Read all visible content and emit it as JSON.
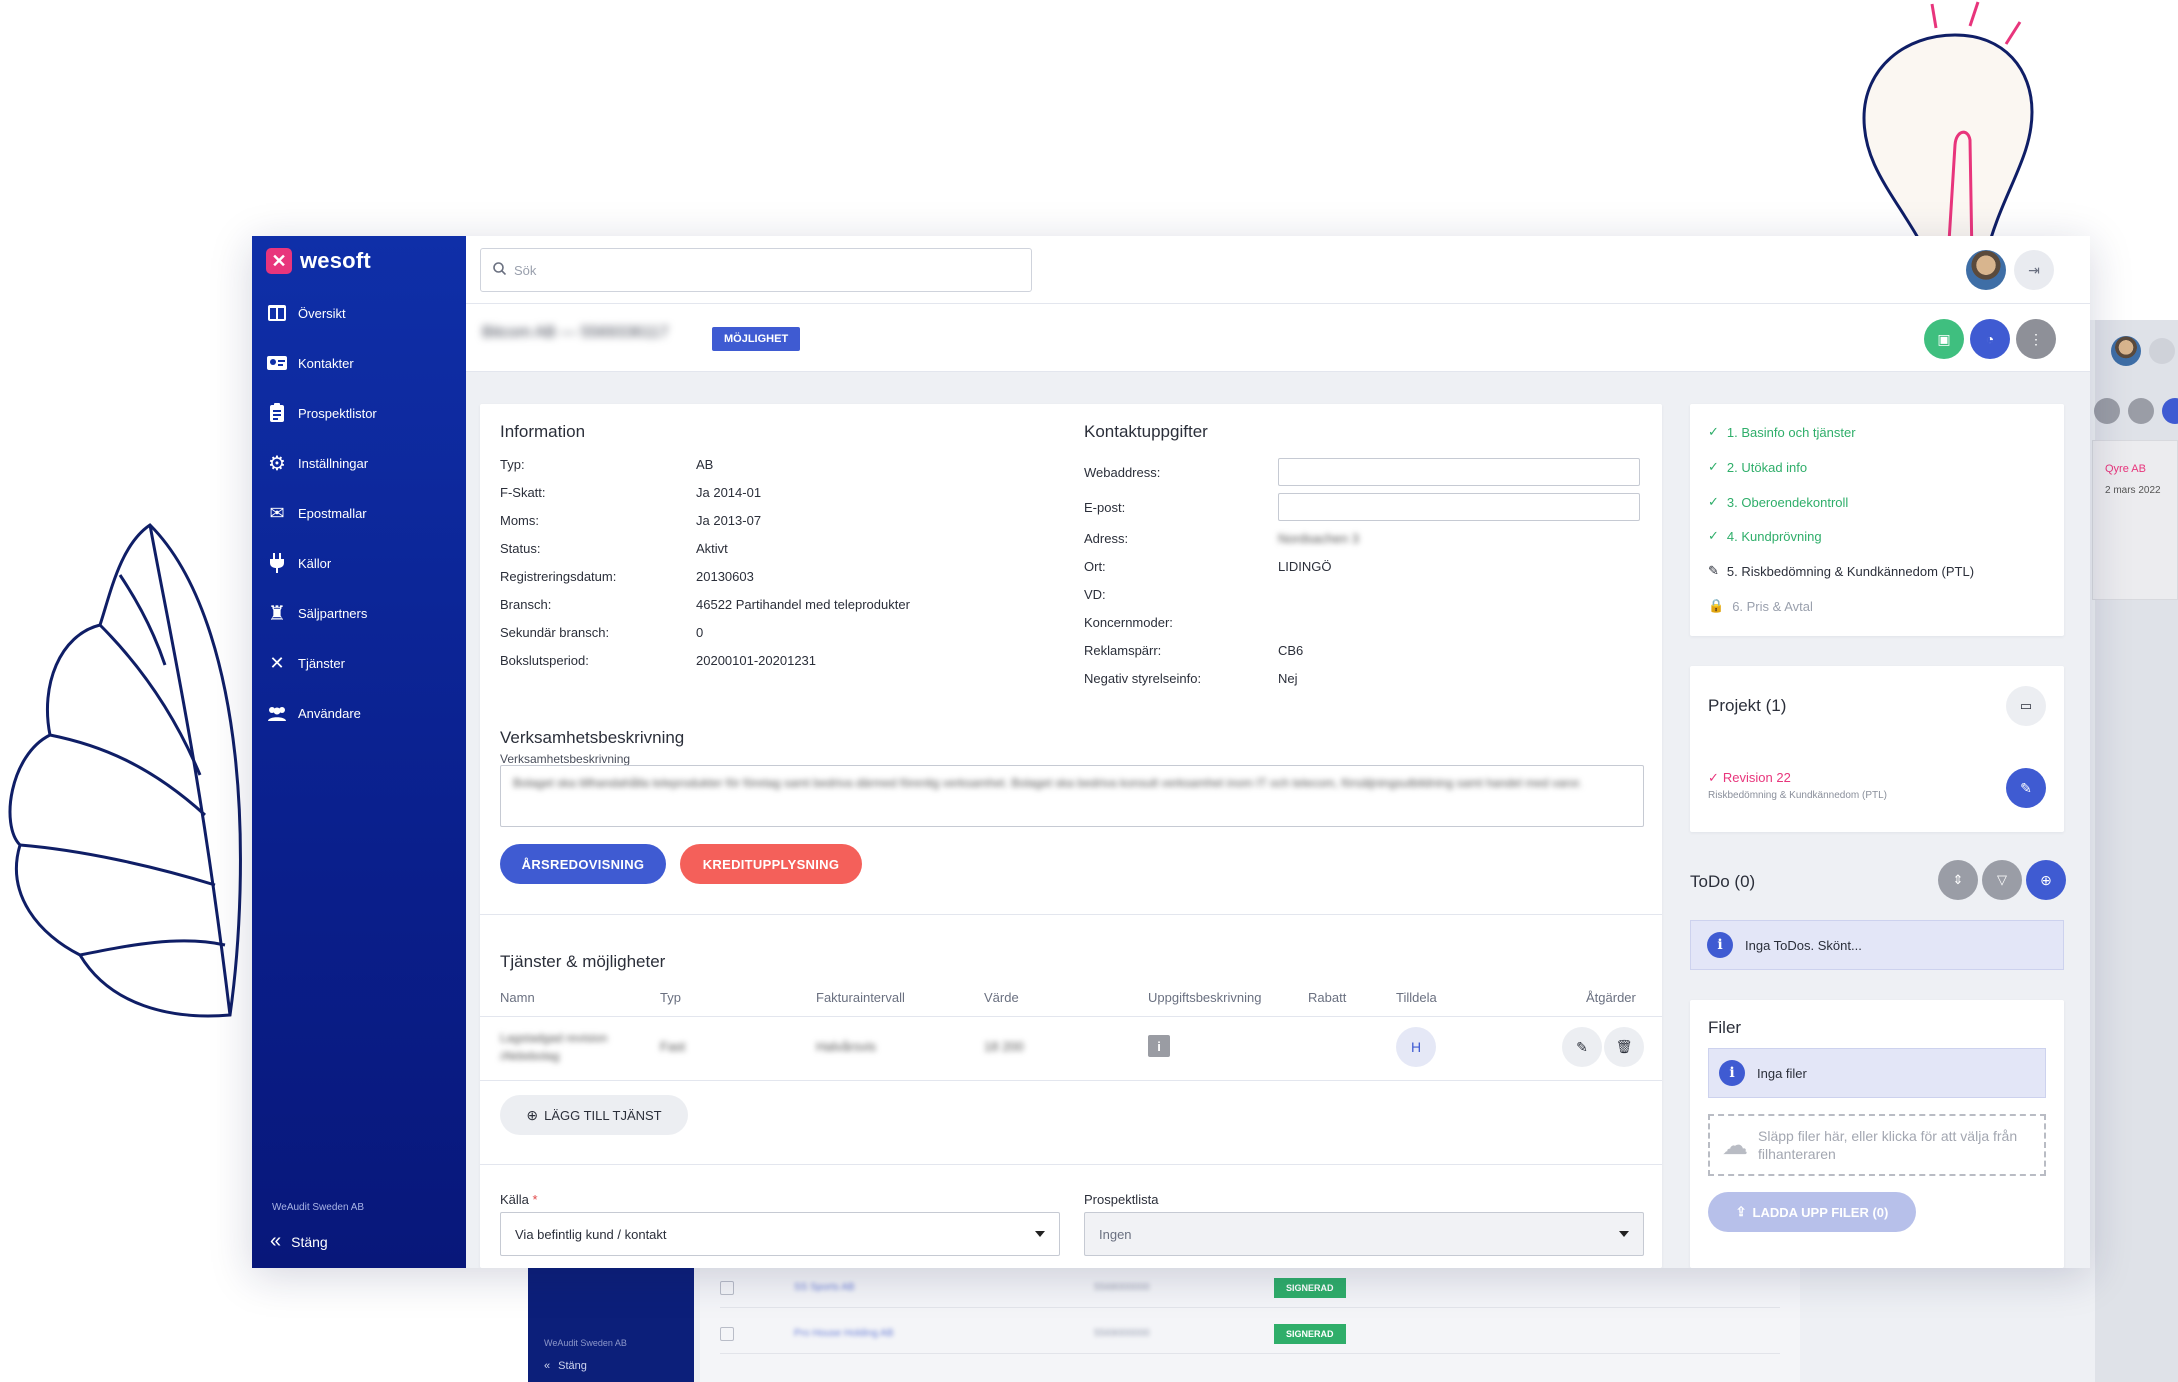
{
  "app": {
    "brand": "wesoft",
    "company_footer": "WeAudit Sweden AB",
    "close_label": "Stäng"
  },
  "sidebar": {
    "items": [
      {
        "label": "Översikt",
        "icon": "dashboard-icon"
      },
      {
        "label": "Kontakter",
        "icon": "contacts-icon"
      },
      {
        "label": "Prospektlistor",
        "icon": "clipboard-list-icon"
      },
      {
        "label": "Inställningar",
        "icon": "gears-icon"
      },
      {
        "label": "Epostmallar",
        "icon": "envelope-icon"
      },
      {
        "label": "Källor",
        "icon": "plug-icon"
      },
      {
        "label": "Säljpartners",
        "icon": "chess-rook-icon"
      },
      {
        "label": "Tjänster",
        "icon": "tools-icon"
      },
      {
        "label": "Användare",
        "icon": "users-icon"
      }
    ]
  },
  "topbar": {
    "search_placeholder": "Sök"
  },
  "header": {
    "company": "Bitcom AB — 5569336117",
    "badge": "MÖJLIGHET"
  },
  "information": {
    "title": "Information",
    "rows": [
      {
        "k": "Typ:",
        "v": "AB"
      },
      {
        "k": "F-Skatt:",
        "v": "Ja 2014-01"
      },
      {
        "k": "Moms:",
        "v": "Ja 2013-07"
      },
      {
        "k": "Status:",
        "v": "Aktivt"
      },
      {
        "k": "Registreringsdatum:",
        "v": "20130603"
      },
      {
        "k": "Bransch:",
        "v": "46522 Partihandel med teleprodukter"
      },
      {
        "k": "Sekundär bransch:",
        "v": "0"
      },
      {
        "k": "Bokslutsperiod:",
        "v": "20200101-20201231"
      }
    ]
  },
  "contact": {
    "title": "Kontaktuppgifter",
    "web_label": "Webaddress:",
    "email_label": "E-post:",
    "rows": [
      {
        "k": "Adress:",
        "v": "Nordsachen 3"
      },
      {
        "k": "Ort:",
        "v": "LIDINGÖ"
      },
      {
        "k": "VD:",
        "v": ""
      },
      {
        "k": "Koncernmoder:",
        "v": ""
      },
      {
        "k": "Reklamspärr:",
        "v": "CB6"
      },
      {
        "k": "Negativ styrelseinfo:",
        "v": "Nej"
      }
    ]
  },
  "business": {
    "title": "Verksamhetsbeskrivning",
    "label": "Verksamhetsbeskrivning",
    "text": "Bolaget ska tillhandahålla teleprodukter för företag samt bedriva därmed förenlig verksamhet. Bolaget ska bedriva konsult verksamhet inom IT och telecom, försäljningsutbildning samt handel med varor."
  },
  "buttons": {
    "annual_report": "ÅRSREDOVISNING",
    "credit_report": "KREDITUPPLYSNING",
    "add_service": "LÄGG TILL TJÄNST"
  },
  "services": {
    "title": "Tjänster & möjligheter",
    "columns": [
      "Namn",
      "Typ",
      "Fakturaintervall",
      "Värde",
      "Uppgiftsbeskrivning",
      "Rabatt",
      "Tilldela",
      "Åtgärder"
    ],
    "rows": [
      {
        "name": "Lagstadgad revision /Aktiebolag",
        "type": "Fast",
        "interval": "Halvårsvis",
        "value": "18 200",
        "assignee": "H"
      }
    ]
  },
  "source": {
    "label": "Källa",
    "required_mark": "*",
    "value": "Via befintlig kund / kontakt",
    "prospect_label": "Prospektlista",
    "prospect_value": "Ingen"
  },
  "steps": [
    {
      "label": "1. Basinfo och tjänster",
      "state": "done"
    },
    {
      "label": "2. Utökad info",
      "state": "done"
    },
    {
      "label": "3. Oberoendekontroll",
      "state": "done"
    },
    {
      "label": "4. Kundprövning",
      "state": "done"
    },
    {
      "label": "5. Riskbedömning & Kundkännedom (PTL)",
      "state": "current"
    },
    {
      "label": "6. Pris & Avtal",
      "state": "locked"
    }
  ],
  "project": {
    "title": "Projekt (1)",
    "item_name": "Revision 22",
    "item_sub": "Riskbedömning & Kundkännedom (PTL)"
  },
  "todo": {
    "title": "ToDo (0)",
    "empty": "Inga ToDos. Skönt..."
  },
  "files": {
    "title": "Filer",
    "empty": "Inga filer",
    "drop_hint": "Släpp filer här, eller klicka för att välja från filhanteraren",
    "upload": "LADDA UPP FILER (0)"
  },
  "background": {
    "side_company": "WeAudit Sweden AB",
    "side_close": "Stäng",
    "card_title": "Qyre AB",
    "card_date": "2 mars 2022",
    "status": "SIGNERAD"
  },
  "colors": {
    "sidebar": "#0f2fa8",
    "primary": "#3f5bd2",
    "success": "#3fbf7f",
    "danger": "#f4605a",
    "accent_pink": "#e8357c"
  }
}
